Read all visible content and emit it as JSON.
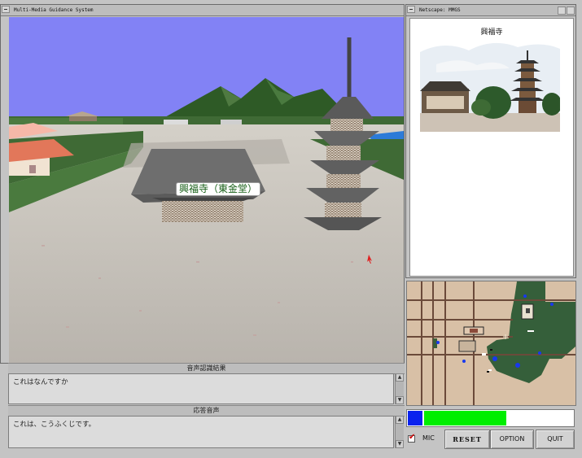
{
  "main_window": {
    "title": "Multi-Media Guidance System"
  },
  "scene": {
    "label": "興福寺（東金堂）"
  },
  "recognition": {
    "header": "音声認識結果",
    "text": "これはなんですか"
  },
  "response": {
    "header": "応答音声",
    "text": "これは、こうふくじです。"
  },
  "browser": {
    "title": "Netscape: MMGS",
    "page_title": "興福寺"
  },
  "controls": {
    "mic_label": "MIC",
    "mic_checked": true,
    "reset_label": "RESET",
    "option_label": "OPTION",
    "quit_label": "QUIT",
    "level_fraction": 0.55
  },
  "colors": {
    "sky": "#8282f5",
    "mountain": "#2e5a26",
    "ground": "#c7c3bd",
    "map_bg": "#d8c0a6",
    "map_park": "#355f3a",
    "level_fill": "#00ee00",
    "level_marker": "#0a22ee"
  }
}
